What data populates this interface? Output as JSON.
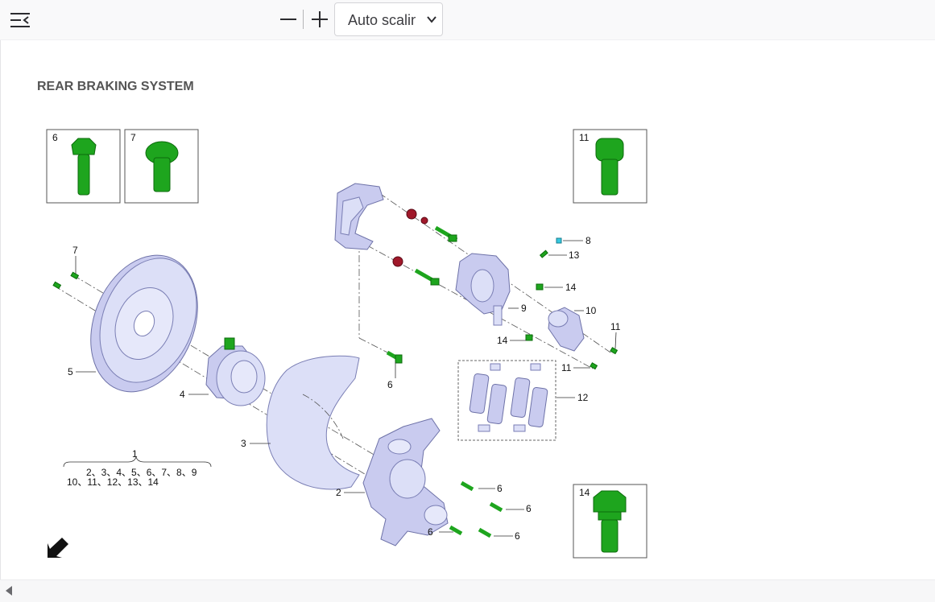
{
  "toolbar": {
    "sidebar_icon": "sidebar-toggle-icon",
    "zoom_out_icon": "minus-icon",
    "zoom_in_icon": "plus-icon",
    "scale_value": "Auto scaling",
    "chevron_icon": "chevron-down-icon"
  },
  "diagram": {
    "title": "REAR BRAKING SYSTEM",
    "insets": [
      {
        "num": "6"
      },
      {
        "num": "7"
      },
      {
        "num": "11"
      },
      {
        "num": "14"
      }
    ],
    "callouts": {
      "c1": "1",
      "c2": "2",
      "c3": "3",
      "c4": "4",
      "c5": "5",
      "c6a": "6",
      "c6b": "6",
      "c6c": "6",
      "c6d": "6",
      "c6e": "6",
      "c7": "7",
      "c8": "8",
      "c9": "9",
      "c10": "10",
      "c11a": "11",
      "c11b": "11",
      "c12": "12",
      "c13": "13",
      "c14a": "14",
      "c14b": "14"
    },
    "kit_line1": "2、3、4、5、6、7、8、9",
    "kit_line2": "10、11、12、13、14",
    "arrow_icon": "arrow-down-left-icon"
  },
  "scrollbar": {
    "left_icon": "scroll-left-arrow-icon"
  },
  "colors": {
    "part": "#c9cbef",
    "fastener": "#1ea51e",
    "seal": "#a0182a",
    "bleeder": "#35c8e0"
  }
}
